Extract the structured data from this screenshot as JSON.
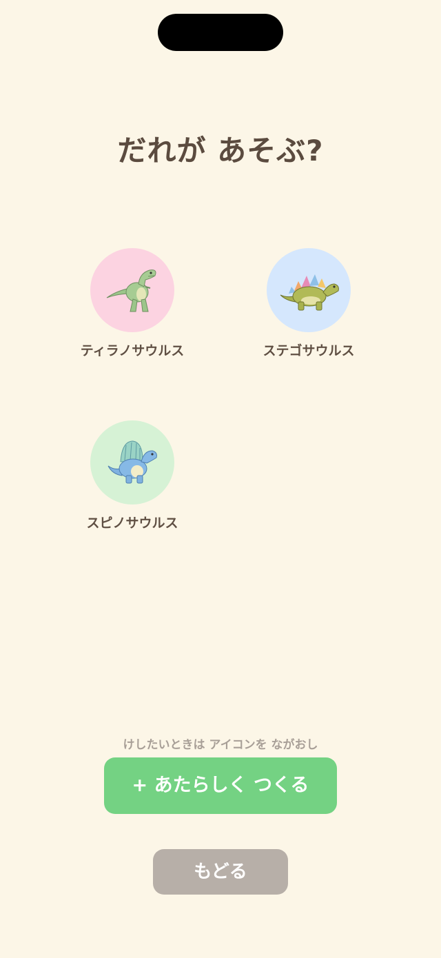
{
  "title": "だれが あそぶ?",
  "profiles": [
    {
      "label": "ティラノサウルス",
      "color": "#FCD3E1",
      "icon": "t-rex-icon"
    },
    {
      "label": "ステゴサウルス",
      "color": "#D5E7FD",
      "icon": "stegosaurus-icon"
    },
    {
      "label": "スピノサウルス",
      "color": "#D6F2D5",
      "icon": "spinosaurus-icon"
    }
  ],
  "hint": "けしたいときは アイコンを ながおし",
  "create_button": "+ あたらしく つくる",
  "back_button": "もどる",
  "colors": {
    "background": "#FCF6E7",
    "primary": "#74D283",
    "secondary": "#B7AFA8",
    "text": "#5B4B3F"
  }
}
